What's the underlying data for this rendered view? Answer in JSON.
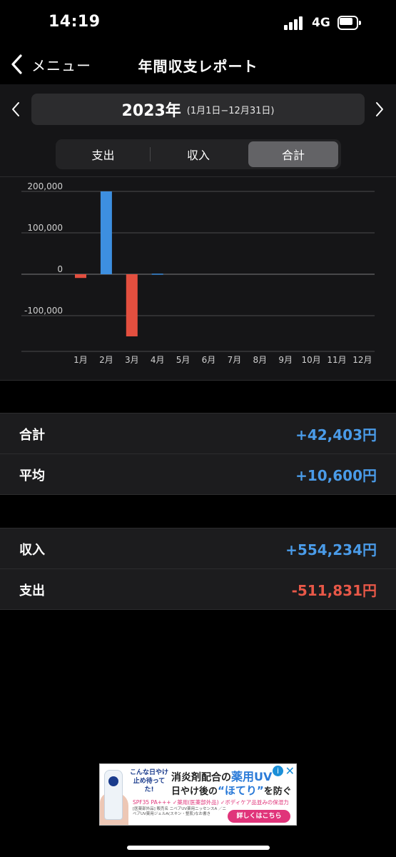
{
  "status_bar": {
    "time": "14:19",
    "network": "4G"
  },
  "nav": {
    "back_label": "メニュー",
    "title": "年間収支レポート"
  },
  "period": {
    "year": "2023年",
    "range": "(1月1日−12月31日)"
  },
  "segments": [
    {
      "label": "支出",
      "active": false
    },
    {
      "label": "収入",
      "active": false
    },
    {
      "label": "合計",
      "active": true
    }
  ],
  "chart_data": {
    "type": "bar",
    "categories": [
      "1月",
      "2月",
      "3月",
      "4月",
      "5月",
      "6月",
      "7月",
      "8月",
      "9月",
      "10月",
      "11月",
      "12月"
    ],
    "values": [
      -9000,
      200000,
      -150000,
      1400,
      0,
      0,
      0,
      0,
      0,
      0,
      0,
      0
    ],
    "y_ticks": [
      200000,
      100000,
      0,
      -100000
    ],
    "y_tick_labels": [
      "200,000",
      "100,000",
      "0",
      "-100,000"
    ],
    "ylim": [
      -185000,
      200000
    ],
    "grid": true,
    "colors": {
      "positive": "#3d8fe0",
      "negative": "#e34f3f"
    }
  },
  "summary": [
    {
      "label": "合計",
      "value": "+42,403円",
      "color": "blue"
    },
    {
      "label": "平均",
      "value": "+10,600円",
      "color": "blue"
    }
  ],
  "breakdown": [
    {
      "label": "収入",
      "value": "+554,234円",
      "color": "blue"
    },
    {
      "label": "支出",
      "value": "-511,831円",
      "color": "red"
    }
  ],
  "ad": {
    "bubble": "こんな日やけ止め待ってた!",
    "headline_pre": "消炎剤配合の",
    "headline_em": "薬用UV",
    "headline2_pre": "日やけ後の",
    "headline2_em": "“ほてり”",
    "headline2_post": "を防ぐ",
    "features_pre": "SPF35 PA+++",
    "features_1": "✓薬用(医薬部外品)",
    "features_2": "✓ボディケア品並みの保湿力",
    "small_print": "[医薬部外品] 販売名 ニベアUV薬用ニッセンスA ／ニベアUV薬用ジェルA(スキン・整肌)なお書き",
    "cta": "詳しくはこちら",
    "info": "i",
    "close": "✕"
  },
  "icons": [
    "chevron-left-icon",
    "chevron-right-icon",
    "signal-icon",
    "battery-icon"
  ]
}
